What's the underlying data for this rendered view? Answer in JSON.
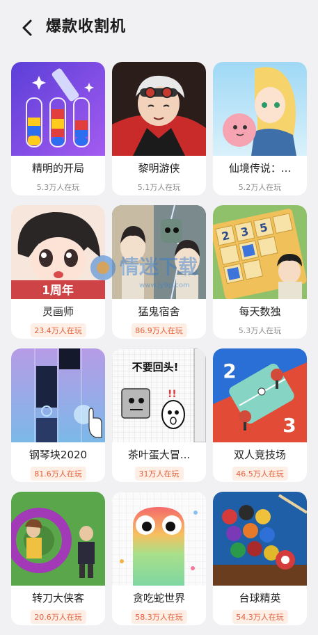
{
  "header": {
    "title": "爆款收割机"
  },
  "watermark": {
    "text": "情迷下载",
    "sub": "www.jy9p.com"
  },
  "games": [
    {
      "name": "精明的开局",
      "players": "5.3万人在玩",
      "hot": false
    },
    {
      "name": "黎明游侠",
      "players": "5.1万人在玩",
      "hot": false
    },
    {
      "name": "仙境传说：...",
      "players": "5.2万人在玩",
      "hot": false
    },
    {
      "name": "灵画师",
      "players": "23.4万人在玩",
      "hot": true,
      "badge": "1周年"
    },
    {
      "name": "猛鬼宿舍",
      "players": "86.9万人在玩",
      "hot": true
    },
    {
      "name": "每天数独",
      "players": "5.3万人在玩",
      "hot": false
    },
    {
      "name": "钢琴块2020",
      "players": "81.6万人在玩",
      "hot": true
    },
    {
      "name": "茶叶蛋大冒...",
      "players": "31万人在玩",
      "hot": true,
      "thumb_text": "不要回头!"
    },
    {
      "name": "双人竞技场",
      "players": "46.5万人在玩",
      "hot": true,
      "score_a": "2",
      "score_b": "3"
    },
    {
      "name": "转刀大侠客",
      "players": "20.6万人在玩",
      "hot": true
    },
    {
      "name": "贪吃蛇世界",
      "players": "58.3万人在玩",
      "hot": true
    },
    {
      "name": "台球精英",
      "players": "54.3万人在玩",
      "hot": true
    }
  ]
}
